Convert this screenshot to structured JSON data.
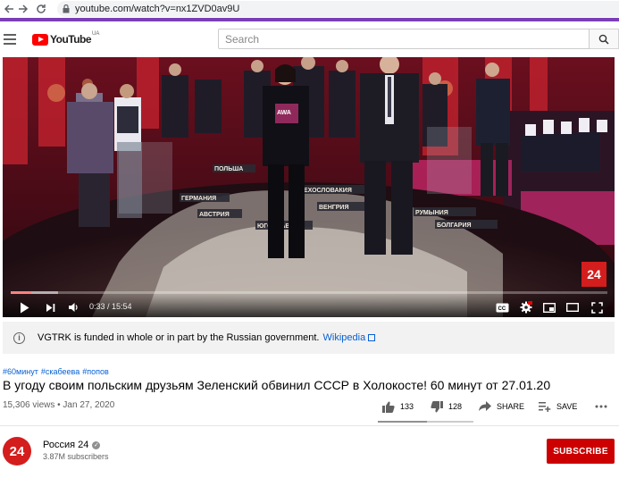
{
  "browser": {
    "url": "youtube.com/watch?v=nx1ZVD0av9U",
    "accent_color": "#7b3fb5"
  },
  "header": {
    "logo_text": "YouTube",
    "region": "UA",
    "search_placeholder": "Search"
  },
  "player": {
    "time": "0:33 / 15:54",
    "progress_fraction": 0.035,
    "buffered_fraction": 0.08,
    "channel_bug": "24",
    "map_labels": [
      "ГЕРМАНИЯ",
      "ЧЕХОСЛОВАКИЯ",
      "АВСТРИЯ",
      "ВЕНГРИЯ",
      "РУМЫНИЯ",
      "ЮГОСЛАВИЯ",
      "БОЛГАРИЯ",
      "ПОЛЬША"
    ],
    "shirt_text": "AWA"
  },
  "notice": {
    "text": "VGTRK is funded in whole or in part by the Russian government.",
    "link": "Wikipedia"
  },
  "video": {
    "hashtags": [
      "#60минут",
      "#скабеева",
      "#попов"
    ],
    "title": "В угоду своим польским друзьям Зеленский обвинил СССР в Холокосте! 60 минут от 27.01.20",
    "views": "15,306 views • Jan 27, 2020",
    "likes": "133",
    "dislikes": "128",
    "share_label": "SHARE",
    "save_label": "SAVE",
    "like_ratio": 0.51
  },
  "channel": {
    "avatar_text": "24",
    "name": "Россия 24",
    "subscribers": "3.87M subscribers",
    "subscribe_label": "SUBSCRIBE"
  }
}
